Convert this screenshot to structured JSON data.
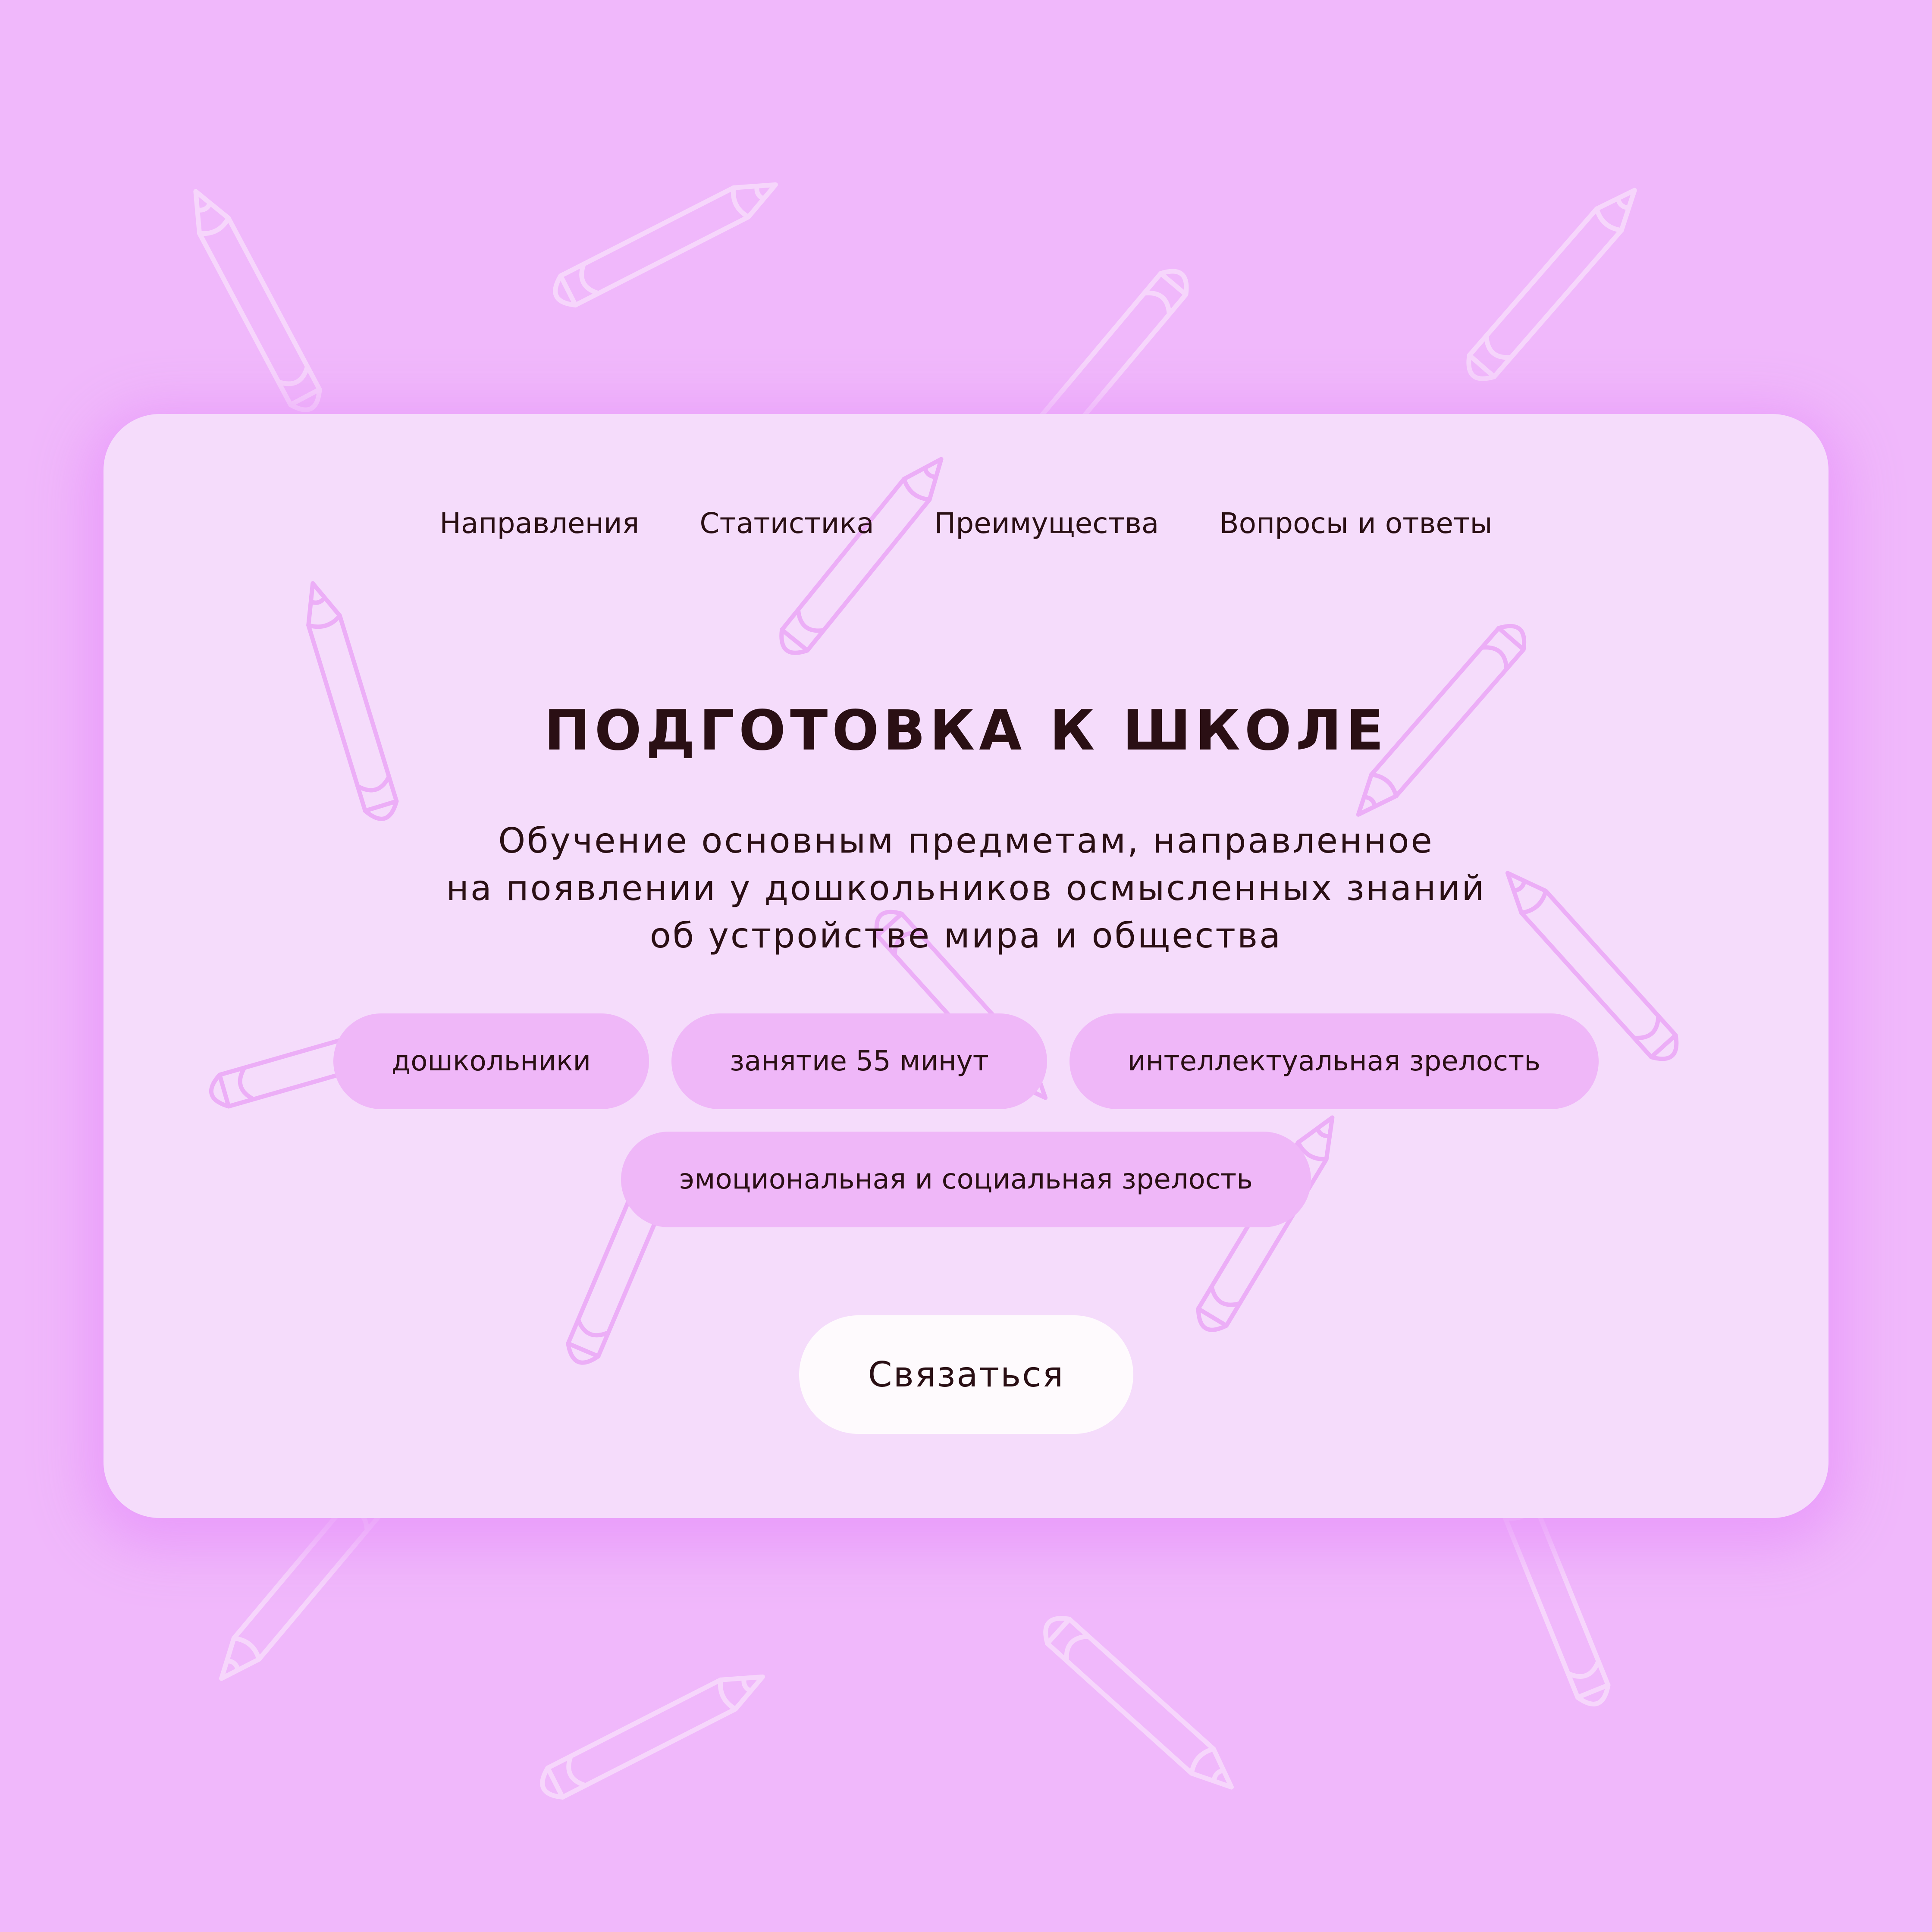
{
  "nav": {
    "items": [
      {
        "label": "Направления"
      },
      {
        "label": "Статистика"
      },
      {
        "label": "Преимущества"
      },
      {
        "label": "Вопросы и ответы"
      }
    ]
  },
  "hero": {
    "title": "ПОДГОТОВКА К ШКОЛЕ",
    "subtitle_lines": [
      "Обучение основным предметам, направленное",
      "на появлении у дошкольников осмысленных знаний",
      "об устройстве мира и общества"
    ],
    "tags": [
      {
        "label": "дошкольники"
      },
      {
        "label": "занятие 55 минут"
      },
      {
        "label": "интеллектуальная зрелость"
      },
      {
        "label": "эмоциональная и социальная зрелость"
      }
    ],
    "cta_label": "Связаться"
  },
  "colors": {
    "background": "#f0b8fb",
    "card": "#f5dcfb",
    "tag": "#efb7f8",
    "cta": "#fefafd",
    "text": "#2a0f14",
    "pencil_outline_bg": "#f6d6fb",
    "pencil_outline_card": "#ecaef7"
  },
  "decorations": {
    "pattern_icon": "pencil-icon"
  }
}
